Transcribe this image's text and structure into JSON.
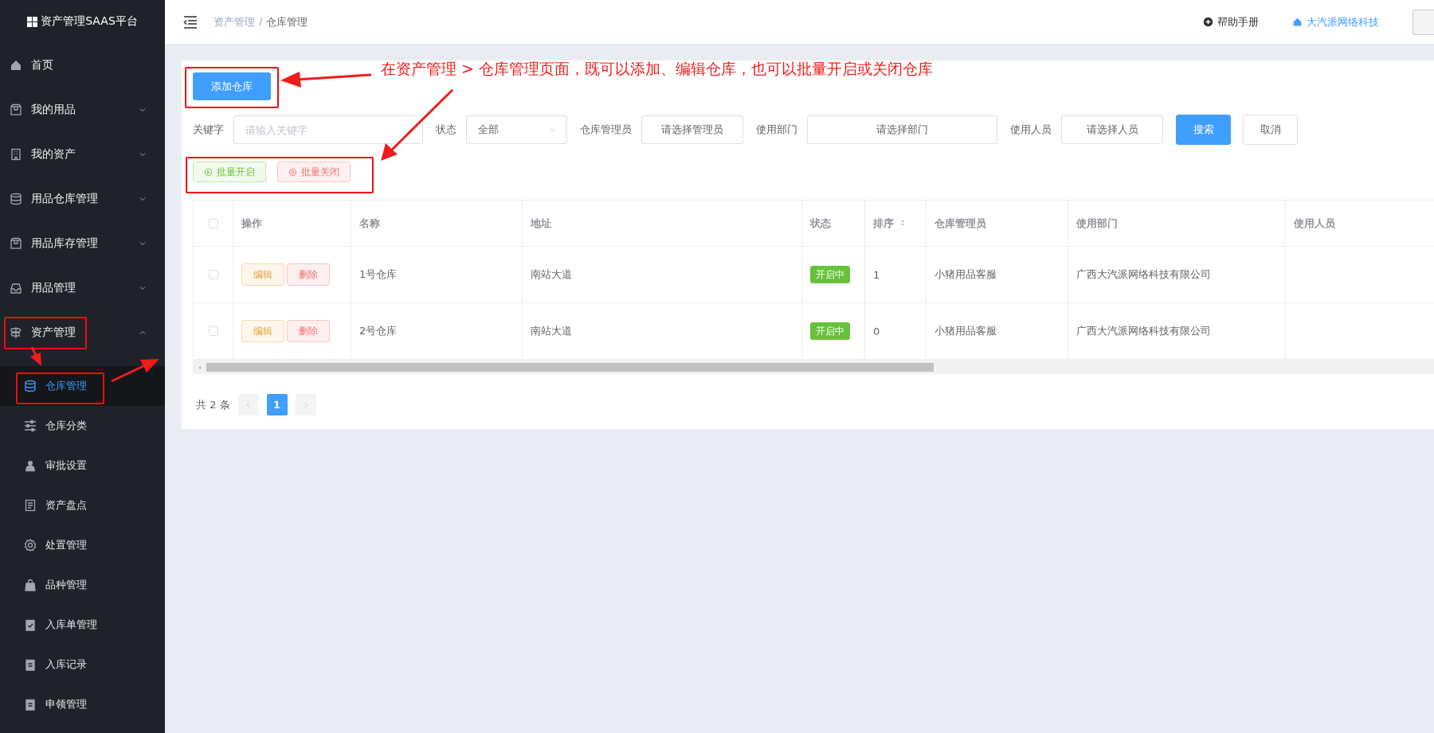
{
  "sidebar": {
    "logo": "资产管理SAAS平台",
    "items": [
      {
        "label": "首页",
        "kind": "link"
      },
      {
        "label": "我的用品",
        "kind": "group",
        "expanded": false
      },
      {
        "label": "我的资产",
        "kind": "group",
        "expanded": false
      },
      {
        "label": "用品仓库管理",
        "kind": "group",
        "expanded": false
      },
      {
        "label": "用品库存管理",
        "kind": "group",
        "expanded": false
      },
      {
        "label": "用品管理",
        "kind": "group",
        "expanded": false
      },
      {
        "label": "资产管理",
        "kind": "group",
        "expanded": true,
        "children": [
          {
            "label": "仓库管理",
            "selected": true
          },
          {
            "label": "仓库分类",
            "selected": false
          },
          {
            "label": "审批设置",
            "selected": false
          },
          {
            "label": "资产盘点",
            "selected": false
          },
          {
            "label": "处置管理",
            "selected": false
          },
          {
            "label": "品种管理",
            "selected": false
          },
          {
            "label": "入库单管理",
            "selected": false
          },
          {
            "label": "入库记录",
            "selected": false
          },
          {
            "label": "申领管理",
            "selected": false
          }
        ]
      }
    ]
  },
  "header": {
    "breadcrumb": [
      "资产管理",
      "仓库管理"
    ],
    "breadcrumb_separator": "/",
    "help": "帮助手册",
    "company": "大汽派网络科技"
  },
  "toolbar": {
    "add_button": "添加仓库"
  },
  "filters": [
    {
      "label": "关键字",
      "kind": "input",
      "placeholder": "请输入关键字"
    },
    {
      "label": "状态",
      "kind": "select",
      "value": "全部"
    },
    {
      "label": "仓库管理员",
      "kind": "picker",
      "value": "请选择管理员"
    },
    {
      "label": "使用部门",
      "kind": "picker",
      "value": "请选择部门"
    },
    {
      "label": "使用人员",
      "kind": "picker",
      "value": "请选择人员"
    }
  ],
  "filter_buttons": [
    {
      "label": "搜索",
      "kind": "primary"
    },
    {
      "label": "取消",
      "kind": "default"
    }
  ],
  "batch_buttons": [
    {
      "label": "批量开启",
      "kind": "enable"
    },
    {
      "label": "批量关闭",
      "kind": "disable"
    }
  ],
  "table": {
    "header_checked": false,
    "columns": [
      {
        "label": "操作",
        "sortable": false
      },
      {
        "label": "名称",
        "sortable": false
      },
      {
        "label": "地址",
        "sortable": false
      },
      {
        "label": "状态",
        "sortable": false
      },
      {
        "label": "排序",
        "sortable": true
      },
      {
        "label": "仓库管理员",
        "sortable": false
      },
      {
        "label": "使用部门",
        "sortable": false
      },
      {
        "label": "使用人员",
        "sortable": false
      }
    ],
    "rows": [
      {
        "checked": false,
        "actions": [
          "编辑",
          "删除"
        ],
        "name": "1号仓库",
        "address": "南站大道",
        "status": "开启中",
        "sort": "1",
        "manager": "小猪用品客服",
        "department": "广西大汽派网络科技有限公司"
      },
      {
        "checked": false,
        "actions": [
          "编辑",
          "删除"
        ],
        "name": "2号仓库",
        "address": "南站大道",
        "status": "开启中",
        "sort": "0",
        "manager": "小猪用品客服",
        "department": "广西大汽派网络科技有限公司"
      }
    ]
  },
  "pagination": {
    "total": "共 2 条",
    "pages": [
      {
        "label": "1",
        "selected": true
      }
    ]
  },
  "annotation": {
    "text": "在资产管理 > 仓库管理页面，既可以添加、编辑仓库，也可以批量开启或关闭仓库"
  }
}
